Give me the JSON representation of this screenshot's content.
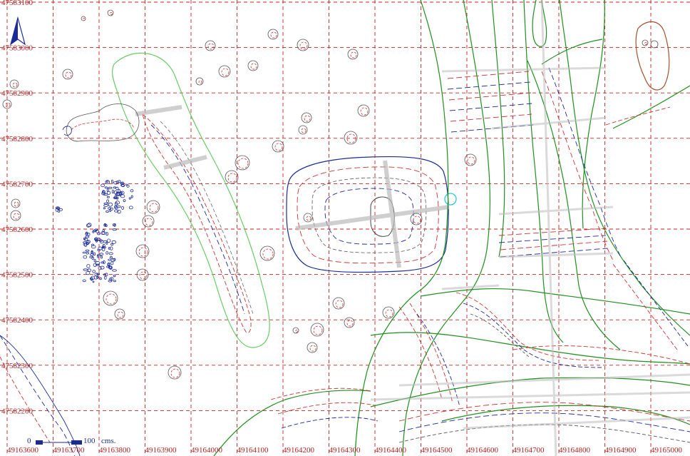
{
  "colors": {
    "grid": "#cc2222",
    "grid_label": "#b22222",
    "contour_red": "#cc3333",
    "contour_blue": "#1a2a9a",
    "contour_gray": "#555555",
    "vegetation_green": "#1f8f1f",
    "light_green": "#66cc66",
    "road_gray": "#bbbbbb",
    "brown": "#a0522d",
    "cyan": "#22cccc",
    "north_arrow": "#1a2a9a"
  },
  "axes": {
    "x_ticks": [
      "49163600",
      "49163700",
      "49163800",
      "49163900",
      "49164000",
      "49164100",
      "49164200",
      "49164300",
      "49164400",
      "49164500",
      "49164600",
      "49164700",
      "49164800",
      "49164900",
      "49165000"
    ],
    "y_ticks": [
      "47583100",
      "47583000",
      "47582900",
      "47582800",
      "47582700",
      "47582600",
      "47582500",
      "47582400",
      "47582300",
      "47582200"
    ]
  },
  "scale_bar": {
    "start_label": "0",
    "end_label": "100",
    "unit": "cms."
  },
  "north_arrow": {
    "icon": "north-arrow-icon"
  }
}
